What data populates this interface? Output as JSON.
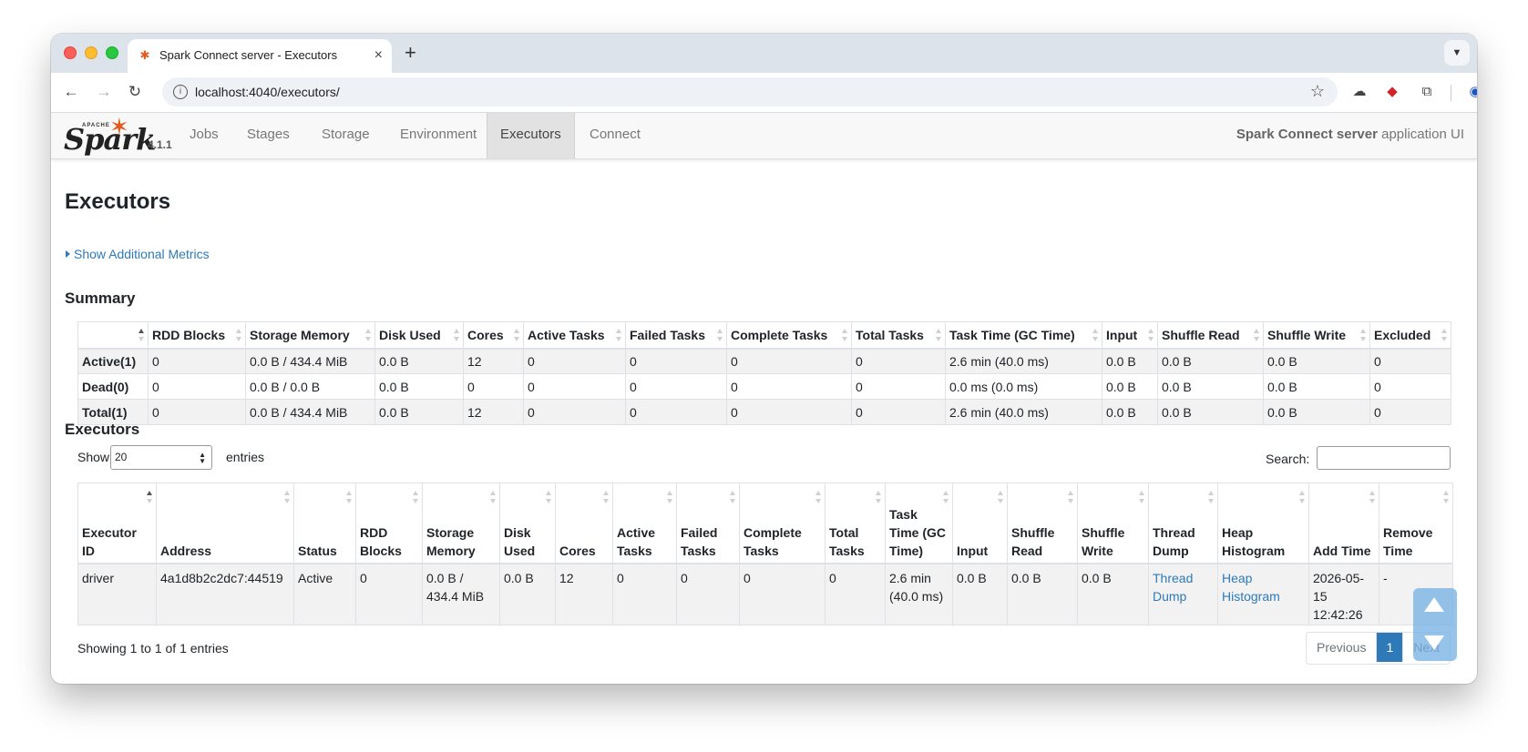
{
  "browser": {
    "tab_title": "Spark Connect server - Executors",
    "tab_close": "×",
    "new_tab": "+",
    "url": "localhost:4040/executors/"
  },
  "spark": {
    "apache_label": "APACHE",
    "brand": "Spark",
    "version": "4.1.1",
    "nav": [
      "Jobs",
      "Stages",
      "Storage",
      "Environment",
      "Executors",
      "Connect"
    ],
    "active_nav": "Executors",
    "app_name": "Spark Connect server",
    "app_suffix": "application UI"
  },
  "page": {
    "title": "Executors",
    "additional_metrics": "Show Additional Metrics",
    "summary_heading": "Summary",
    "executors_heading": "Executors"
  },
  "summary": {
    "headers": [
      "",
      "RDD Blocks",
      "Storage Memory",
      "Disk Used",
      "Cores",
      "Active Tasks",
      "Failed Tasks",
      "Complete Tasks",
      "Total Tasks",
      "Task Time (GC Time)",
      "Input",
      "Shuffle Read",
      "Shuffle Write",
      "Excluded"
    ],
    "rows": [
      [
        "Active(1)",
        "0",
        "0.0 B / 434.4 MiB",
        "0.0 B",
        "12",
        "0",
        "0",
        "0",
        "0",
        "2.6 min (40.0 ms)",
        "0.0 B",
        "0.0 B",
        "0.0 B",
        "0"
      ],
      [
        "Dead(0)",
        "0",
        "0.0 B / 0.0 B",
        "0.0 B",
        "0",
        "0",
        "0",
        "0",
        "0",
        "0.0 ms (0.0 ms)",
        "0.0 B",
        "0.0 B",
        "0.0 B",
        "0"
      ],
      [
        "Total(1)",
        "0",
        "0.0 B / 434.4 MiB",
        "0.0 B",
        "12",
        "0",
        "0",
        "0",
        "0",
        "2.6 min (40.0 ms)",
        "0.0 B",
        "0.0 B",
        "0.0 B",
        "0"
      ]
    ]
  },
  "executors_table": {
    "show_label": "Show",
    "page_size": "20",
    "entries_label": "entries",
    "search_label": "Search:",
    "search_value": "",
    "headers": [
      "Executor ID",
      "Address",
      "Status",
      "RDD Blocks",
      "Storage Memory",
      "Disk Used",
      "Cores",
      "Active Tasks",
      "Failed Tasks",
      "Complete Tasks",
      "Total Tasks",
      "Task Time (GC Time)",
      "Input",
      "Shuffle Read",
      "Shuffle Write",
      "Thread Dump",
      "Heap Histogram",
      "Add Time",
      "Remove Time"
    ],
    "rows": [
      [
        "driver",
        "4a1d8b2c2dc7:44519",
        "Active",
        "0",
        "0.0 B / 434.4 MiB",
        "0.0 B",
        "12",
        "0",
        "0",
        "0",
        "0",
        "2.6 min (40.0 ms)",
        "0.0 B",
        "0.0 B",
        "0.0 B",
        "Thread Dump",
        "Heap Histogram",
        "2026-05-15 12:42:26",
        "-"
      ]
    ],
    "info": "Showing 1 to 1 of 1 entries",
    "pagination": {
      "previous": "Previous",
      "current": "1",
      "next": "Next"
    }
  },
  "colors": {
    "link": "#2e7ab8",
    "spark_orange": "#e25a1c",
    "nav_active_bg": "#e2e2e2"
  }
}
